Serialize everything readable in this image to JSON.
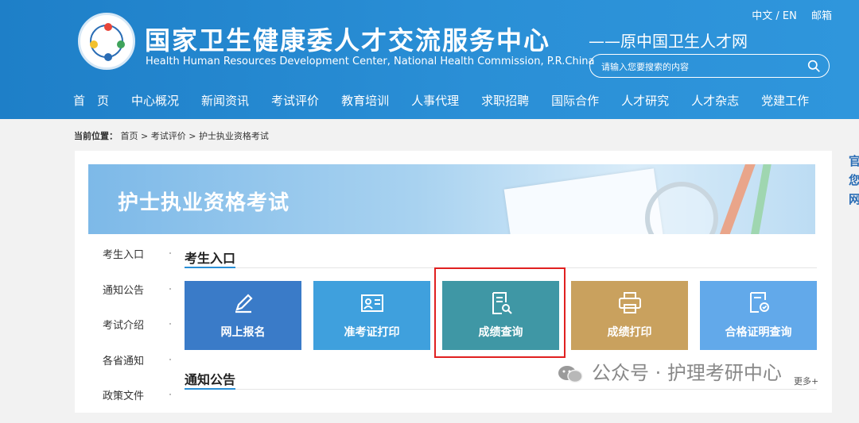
{
  "header": {
    "title_cn": "国家卫生健康委人才交流服务中心",
    "title_en": "Health Human Resources Development Center, National Health Commission, P.R.China",
    "subtitle": "——原中国卫生人才网",
    "top_links": [
      "中文 / EN",
      "邮箱"
    ],
    "search": {
      "placeholder": "请输入您要搜索的内容"
    },
    "nav": [
      "首　页",
      "中心概况",
      "新闻资讯",
      "考试评价",
      "教育培训",
      "人事代理",
      "求职招聘",
      "国际合作",
      "人才研究",
      "人才杂志",
      "党建工作"
    ]
  },
  "breadcrumb": {
    "label": "当前位置：",
    "items": [
      "首页",
      "考试评价",
      "护士执业资格考试"
    ],
    "sep": ">"
  },
  "banner": {
    "title": "护士执业资格考试"
  },
  "sidebar": {
    "items": [
      "考生入口",
      "通知公告",
      "考试介绍",
      "各省通知",
      "政策文件"
    ]
  },
  "sections": {
    "entry_title": "考生入口",
    "notice_title": "通知公告",
    "more": "更多+"
  },
  "tiles": [
    {
      "label": "网上报名",
      "icon": "pencil-icon",
      "color": "#3a7bc8"
    },
    {
      "label": "准考证打印",
      "icon": "id-card-icon",
      "color": "#3fa0dd"
    },
    {
      "label": "成绩查询",
      "icon": "document-search-icon",
      "color": "#3f97a5"
    },
    {
      "label": "成绩打印",
      "icon": "printer-icon",
      "color": "#c9a15e"
    },
    {
      "label": "合格证明查询",
      "icon": "certificate-icon",
      "color": "#62a9ea"
    }
  ],
  "watermark": "公众号 · 护理考研中心",
  "edge_chars": [
    "官",
    "您",
    "网"
  ]
}
